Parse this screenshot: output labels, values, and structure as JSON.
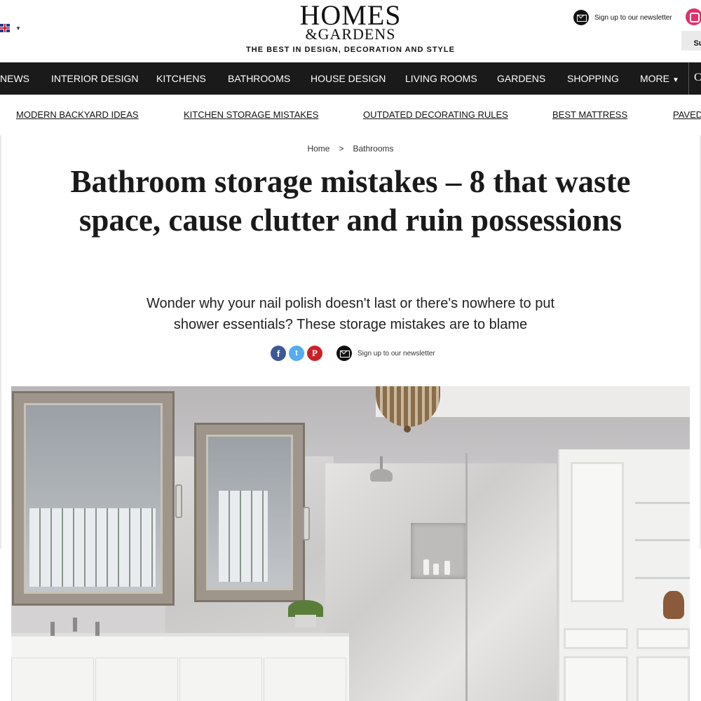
{
  "header": {
    "logo_line1": "HOMES",
    "logo_line2": "&GARDENS",
    "tagline": "THE BEST IN DESIGN, DECORATION AND STYLE",
    "newsletter_label": "Sign up to our newsletter",
    "subscribe_label": "Sul",
    "locale_caret": "▼"
  },
  "nav": {
    "items": [
      "NEWS",
      "INTERIOR DESIGN",
      "KITCHENS",
      "BATHROOMS",
      "HOUSE DESIGN",
      "LIVING ROOMS",
      "GARDENS",
      "SHOPPING",
      "MORE"
    ],
    "more_caret": "▼",
    "overflow_label": "C"
  },
  "trending": {
    "links": [
      "MODERN BACKYARD IDEAS",
      "KITCHEN STORAGE MISTAKES",
      "OUTDATED DECORATING RULES",
      "BEST MATTRESS",
      "PAVED"
    ]
  },
  "article": {
    "breadcrumb": [
      "Home",
      "Bathrooms"
    ],
    "breadcrumb_sep": ">",
    "title": "Bathroom storage mistakes – 8 that waste space, cause clutter and ruin possessions",
    "standfirst": "Wonder why your nail polish doesn't last or there's nowhere to put shower essentials? These storage mistakes are to blame",
    "share": {
      "facebook_glyph": "f",
      "twitter_glyph": "t",
      "pinterest_glyph": "P",
      "newsletter_label": "Sign up to our newsletter"
    }
  },
  "colors": {
    "nav_bg": "#1a1a1a",
    "facebook": "#3b5998",
    "twitter": "#55acee",
    "pinterest": "#cb2027",
    "instagram": "#e1306c"
  },
  "icons": [
    "uk-flag-icon",
    "mail-icon",
    "instagram-icon",
    "facebook-icon",
    "twitter-icon",
    "pinterest-icon"
  ]
}
